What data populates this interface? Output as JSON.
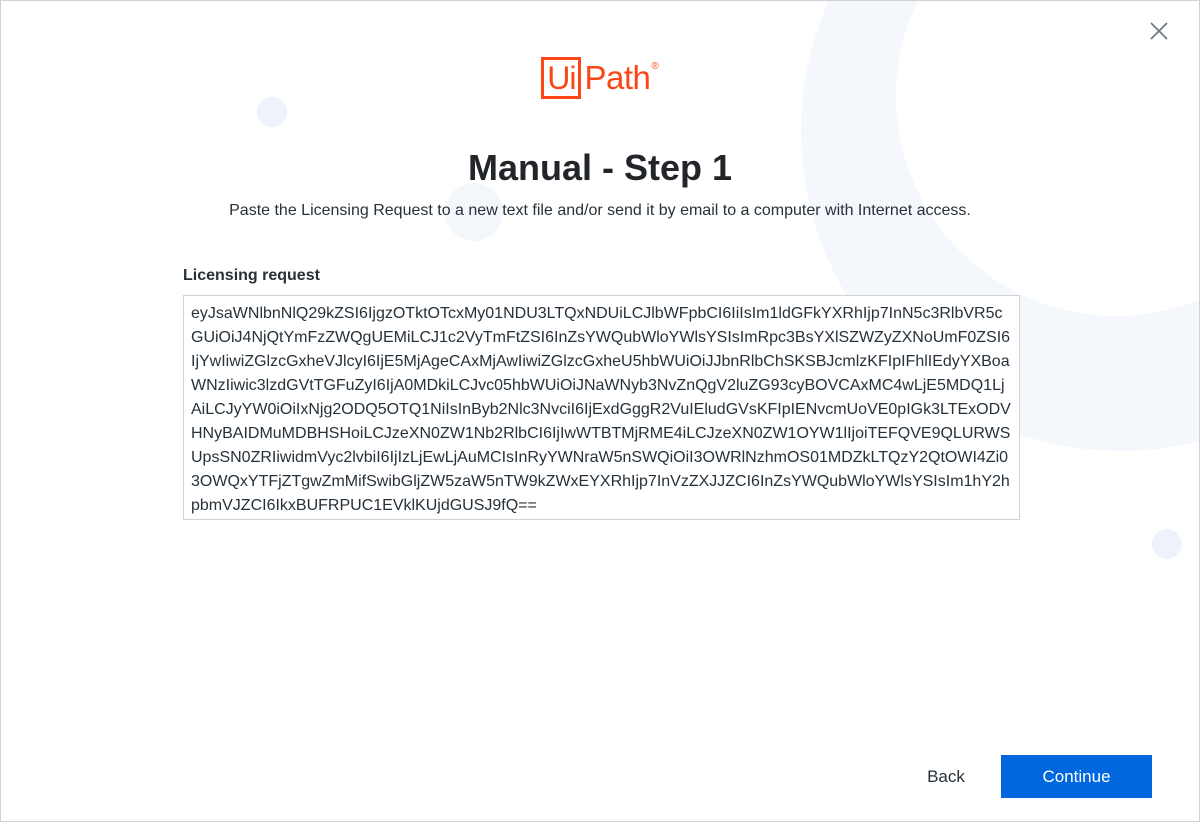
{
  "dialog": {
    "close_icon": "close-icon",
    "logo": {
      "box_text": "Ui",
      "text": "Path",
      "registered": "®",
      "color": "#fa4616"
    },
    "title": "Manual - Step 1",
    "subtitle": "Paste the Licensing Request to a new text file and/or send it by email to a computer with Internet access.",
    "field_label": "Licensing request",
    "licensing_request_value": "eyJsaWNlbnNlQ29kZSI6IjgzOTktOTcxMy01NDU3LTQxNDUiLCJlbWFpbCI6IiIsIm1ldGFkYXRhIjp7InN5c3RlbVR5cGUiOiJ4NjQtYmFzZWQgUEMiLCJ1c2VyTmFtZSI6InZsYWQubWloYWlsYSIsImRpc3BsYXlSZWZyZXNoUmF0ZSI6IjYwIiwiZGlzcGxheVJlcyI6IjE5MjAgeCAxMjAwIiwiZGlzcGxheU5hbWUiOiJJbnRlbChSKSBJcmlzKFIpIFhlIEdyYXBoaWNzIiwic3lzdGVtTGFuZyI6IjA0MDkiLCJvc05hbWUiOiJNaWNyb3NvZnQgV2luZG93cyBOVCAxMC4wLjE5MDQ1LjAiLCJyYW0iOiIxNjg2ODQ5OTQ1NiIsInByb2Nlc3NvciI6IjExdGggR2VuIEludGVsKFIpIENvcmUoVE0pIGk3LTExODVHNyBAIDMuMDBHSHoiLCJzeXN0ZW1Nb2RlbCI6IjIwWTBTMjRME4iLCJzeXN0ZW1OYW1lIjoiTEFQVE9QLURWSUpsSN0ZRIiwidmVyc2lvbiI6IjIzLjEwLjAuMCIsInRyYWNraW5nSWQiOiI3OWRlNzhmOS01MDZkLTQzY2QtOWI4Zi03OWQxYTFjZTgwZmMifSwibGljZW5zaW5nTW9kZWxEYXRhIjp7InVzZXJJZCI6InZsYWQubWloYWlsYSIsIm1hY2hpbmVJZCI6IkxBUFRPUC1EVklKUjdGUSJ9fQ==",
    "buttons": {
      "back": "Back",
      "continue": "Continue"
    },
    "accent_color": "#0067df"
  }
}
